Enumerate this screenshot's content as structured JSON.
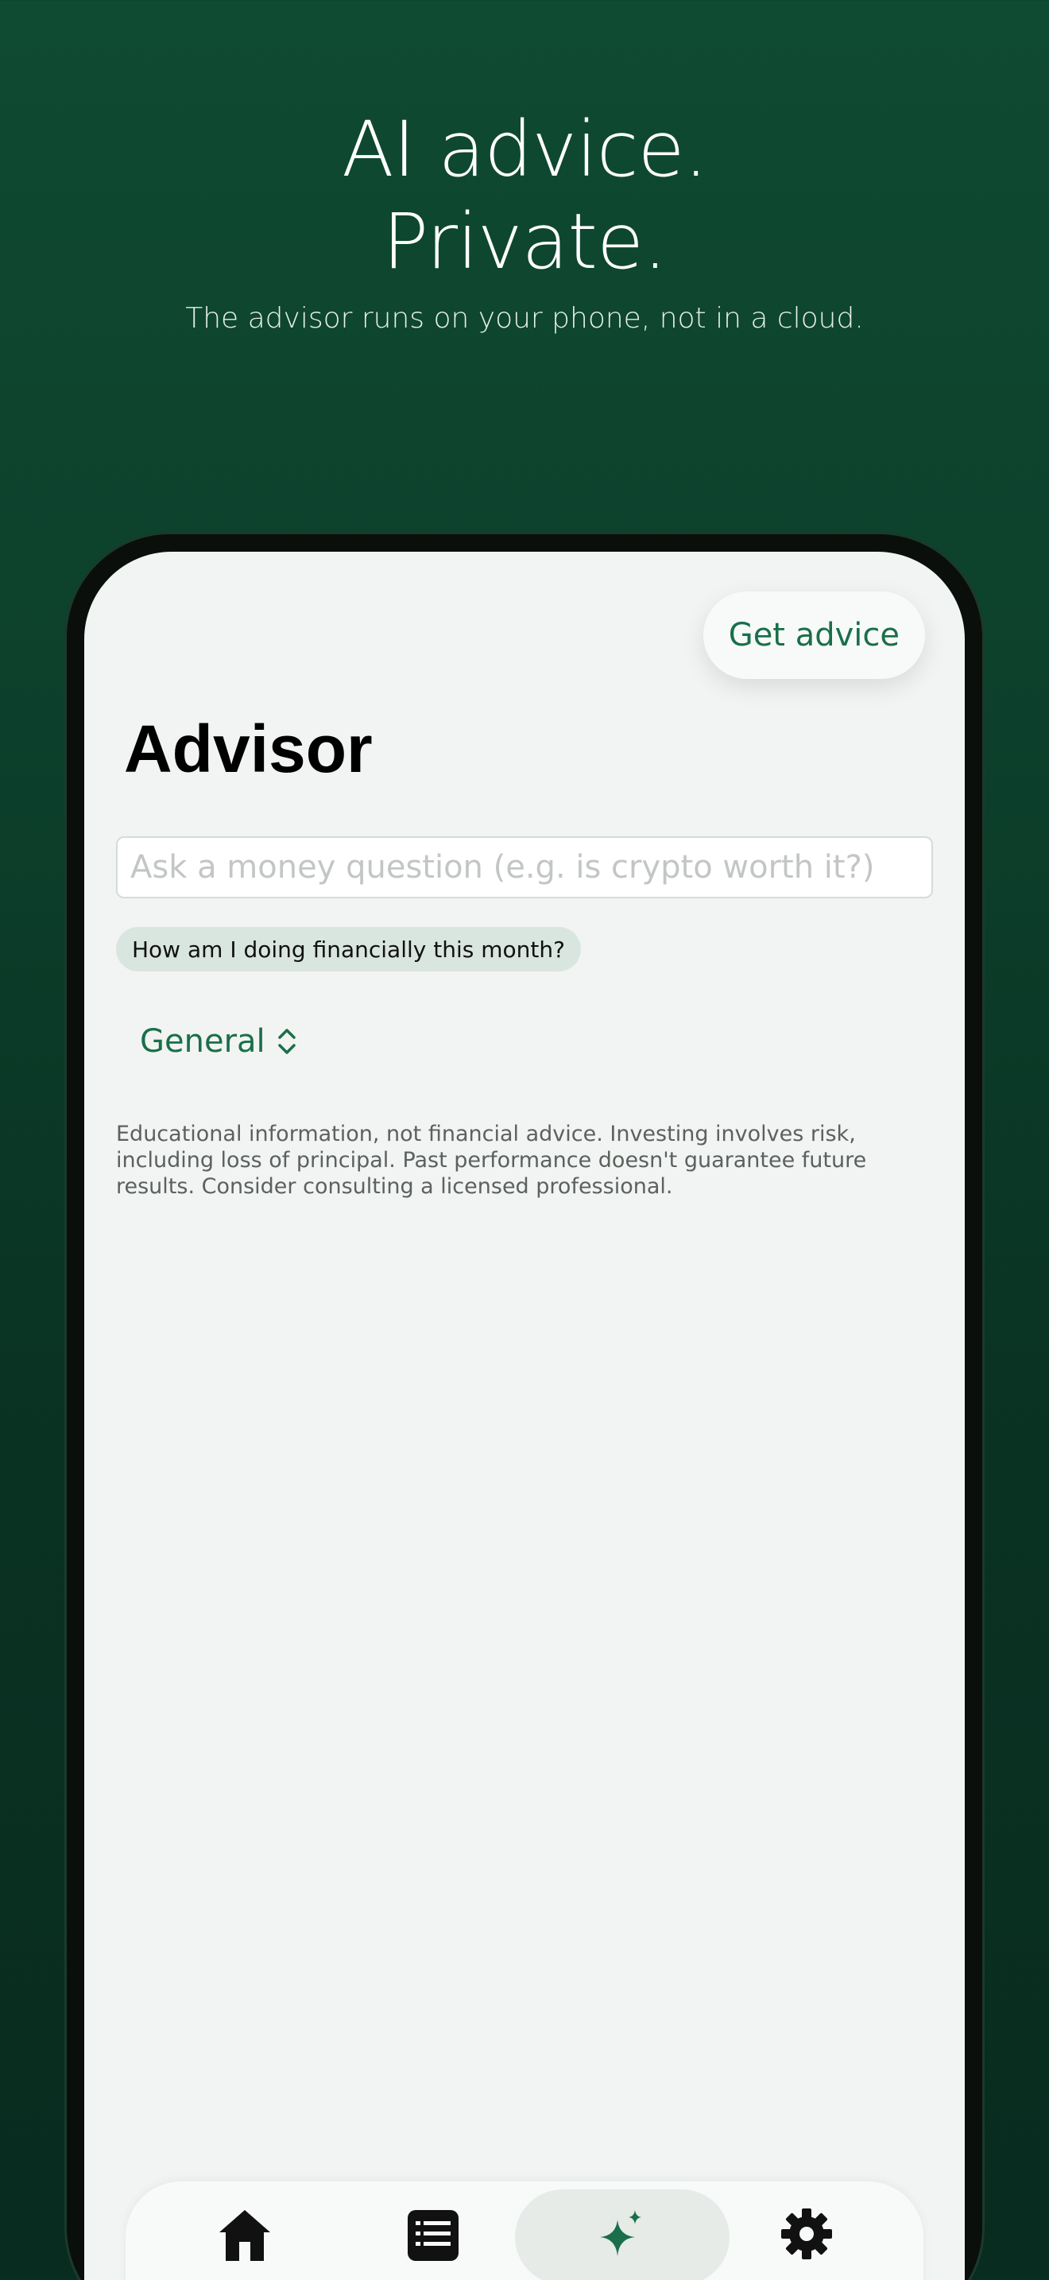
{
  "hero": {
    "title_line1": "AI advice.",
    "title_line2": "Private.",
    "subtitle": "The advisor runs on your phone, not in a cloud."
  },
  "advisor": {
    "get_advice_label": "Get advice",
    "title": "Advisor",
    "input_placeholder": "Ask a money question (e.g. is crypto worth it?)",
    "input_value": "",
    "suggestion": "How am I doing financially this month?",
    "category": "General",
    "disclaimer": "Educational information, not financial advice. Investing involves risk, including loss of principal. Past performance doesn't guarantee future results. Consider consulting a licensed professional."
  },
  "tabbar": {
    "tabs": [
      {
        "icon": "house-icon",
        "active": false
      },
      {
        "icon": "list-icon",
        "active": false
      },
      {
        "icon": "sparkles-icon",
        "active": true
      },
      {
        "icon": "gear-icon",
        "active": false
      }
    ]
  },
  "colors": {
    "accent": "#1a6f4a",
    "background_top": "#0f4a32",
    "screen_bg": "#f1f4f2",
    "chip_bg": "#d9e6df"
  }
}
